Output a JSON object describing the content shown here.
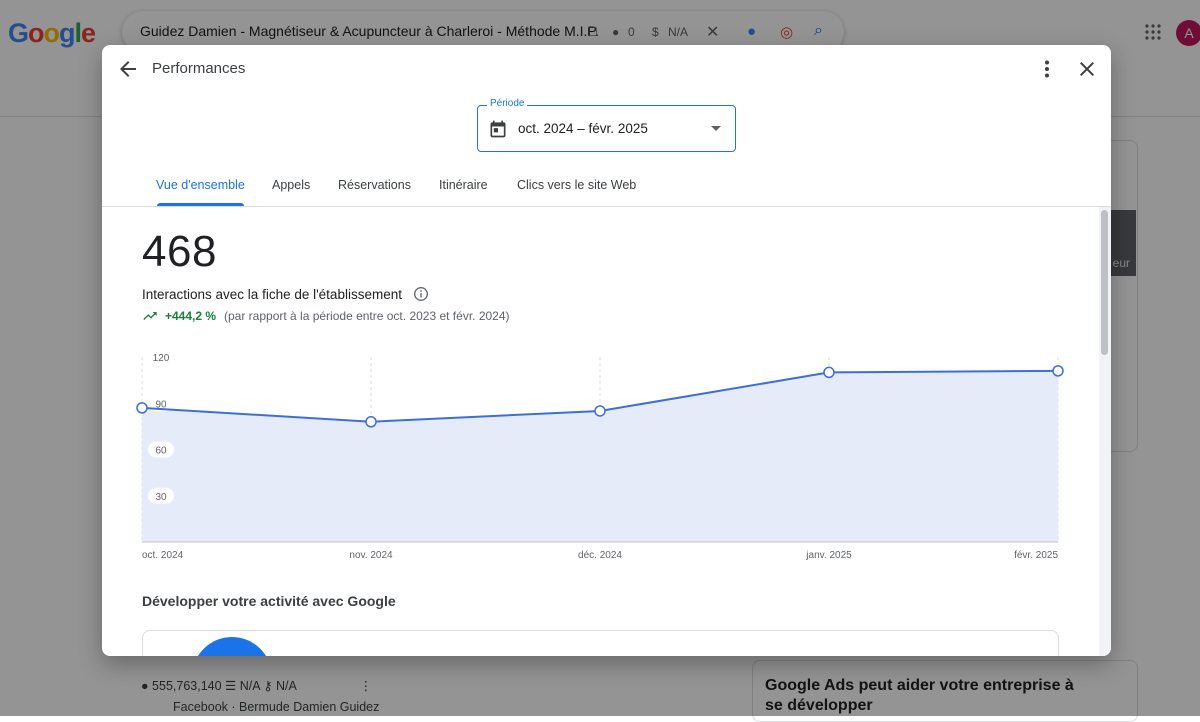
{
  "background": {
    "search_query": "Guidez Damien - Magnétiseur & Acupuncteur à Charleroi - Méthode M.I.P.",
    "chip_count": "0",
    "chip_na": "N/A",
    "avatar_letter": "A",
    "right_card_snippet": "eur",
    "stats": {
      "number": "555,763,140",
      "na1": "N/A",
      "na2": "N/A"
    },
    "facebook_line": "Facebook · Bermude Damien Guidez",
    "ads_title": "Google Ads peut aider votre entreprise à se développer"
  },
  "dialog": {
    "title": "Performances",
    "period": {
      "label": "Période",
      "value": "oct. 2024 – févr. 2025"
    },
    "tabs": [
      {
        "label": "Vue d'ensemble",
        "active": true
      },
      {
        "label": "Appels",
        "active": false
      },
      {
        "label": "Réservations",
        "active": false
      },
      {
        "label": "Itinéraire",
        "active": false
      },
      {
        "label": "Clics vers le site Web",
        "active": false
      }
    ],
    "metric": {
      "total": "468",
      "label": "Interactions avec la fiche de l'établissement",
      "trend_value": "+444,2 %",
      "trend_compare": "(par rapport à la période entre oct. 2023 et févr. 2024)"
    },
    "section_title": "Développer votre activité avec Google"
  },
  "chart_data": {
    "type": "area",
    "categories": [
      "oct. 2024",
      "nov. 2024",
      "déc. 2024",
      "janv. 2025",
      "févr. 2025"
    ],
    "values": [
      87,
      78,
      85,
      110,
      111
    ],
    "yticks": [
      30,
      60,
      90,
      120
    ],
    "ylim": [
      0,
      120
    ],
    "grid": "vertical dashed",
    "colors": {
      "line": "#3c6fd8",
      "fill": "#e6ebfa"
    }
  }
}
